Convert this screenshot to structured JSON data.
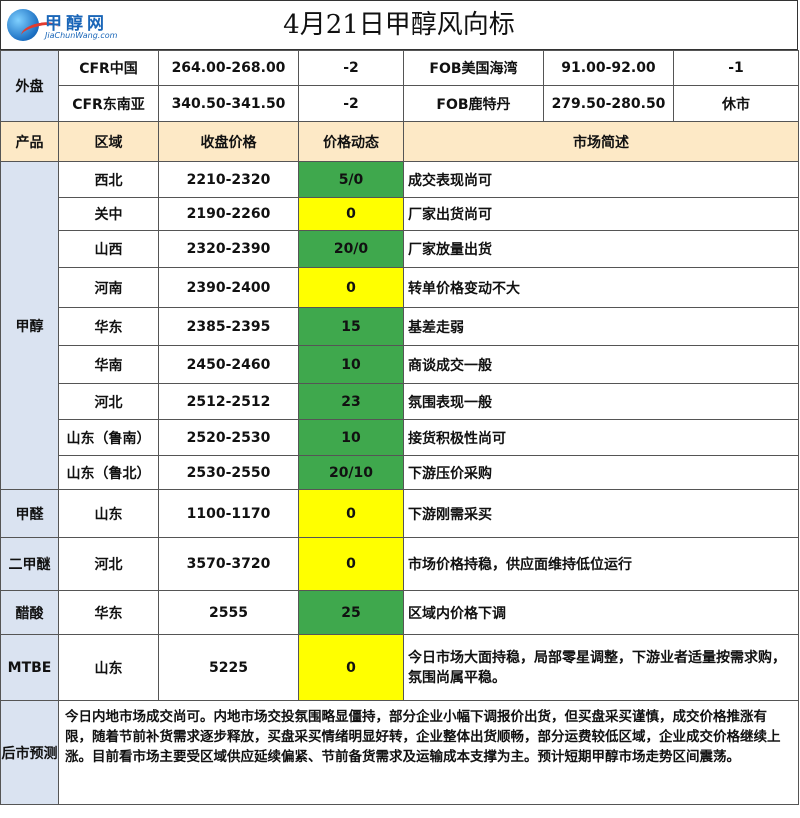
{
  "header": {
    "logo_cn": "甲醇网",
    "logo_en": "JiaChunWang.com",
    "title": "4月21日甲醇风向标"
  },
  "external": {
    "label": "外盘",
    "rows": [
      {
        "m1": "CFR中国",
        "p1": "264.00-268.00",
        "c1": "-2",
        "m2": "FOB美国海湾",
        "p2": "91.00-92.00",
        "c2": "-1"
      },
      {
        "m1": "CFR东南亚",
        "p1": "340.50-341.50",
        "c1": "-2",
        "m2": "FOB鹿特丹",
        "p2": "279.50-280.50",
        "c2": "休市"
      }
    ]
  },
  "columns": {
    "product": "产品",
    "region": "区域",
    "price": "收盘价格",
    "change": "价格动态",
    "desc": "市场简述"
  },
  "methanol": {
    "label": "甲醇",
    "rows": [
      {
        "region": "西北",
        "price": "2210-2320",
        "change": "5/0",
        "desc": "成交表现尚可"
      },
      {
        "region": "关中",
        "price": "2190-2260",
        "change": "0",
        "desc": "厂家出货尚可"
      },
      {
        "region": "山西",
        "price": "2320-2390",
        "change": "20/0",
        "desc": "厂家放量出货"
      },
      {
        "region": "河南",
        "price": "2390-2400",
        "change": "0",
        "desc": "转单价格变动不大"
      },
      {
        "region": "华东",
        "price": "2385-2395",
        "change": "15",
        "desc": "基差走弱"
      },
      {
        "region": "华南",
        "price": "2450-2460",
        "change": "10",
        "desc": "商谈成交一般"
      },
      {
        "region": "河北",
        "price": "2512-2512",
        "change": "23",
        "desc": "氛围表现一般"
      },
      {
        "region": "山东（鲁南）",
        "price": "2520-2530",
        "change": "10",
        "desc": "接货积极性尚可"
      },
      {
        "region": "山东（鲁北）",
        "price": "2530-2550",
        "change": "20/10",
        "desc": "下游压价采购"
      }
    ]
  },
  "others": [
    {
      "product": "甲醛",
      "region": "山东",
      "price": "1100-1170",
      "change": "0",
      "desc": "下游刚需采买"
    },
    {
      "product": "二甲醚",
      "region": "河北",
      "price": "3570-3720",
      "change": "0",
      "desc": "市场价格持稳，供应面维持低位运行"
    },
    {
      "product": "醋酸",
      "region": "华东",
      "price": "2555",
      "change": "25",
      "desc": "区域内价格下调"
    },
    {
      "product": "MTBE",
      "region": "山东",
      "price": "5225",
      "change": "0",
      "desc": "今日市场大面持稳，局部零星调整，下游业者适量按需求购，氛围尚属平稳。"
    }
  ],
  "forecast": {
    "label": "后市预测",
    "text": "今日内地市场成交尚可。内地市场交投氛围略显僵持，部分企业小幅下调报价出货，但买盘采买谨慎，成交价格推涨有限，随着节前补货需求逐步释放，买盘采买情绪明显好转，企业整体出货顺畅，部分运费较低区域，企业成交价格继续上涨。目前看市场主要受区域供应延续偏紧、节前备货需求及运输成本支撑为主。预计短期甲醇市场走势区间震荡。"
  },
  "colors": {
    "header_bg": "#fde9c6",
    "category_bg": "#dae3f1",
    "up_green": "#3fa84d",
    "flat_yellow": "#ffff00"
  }
}
